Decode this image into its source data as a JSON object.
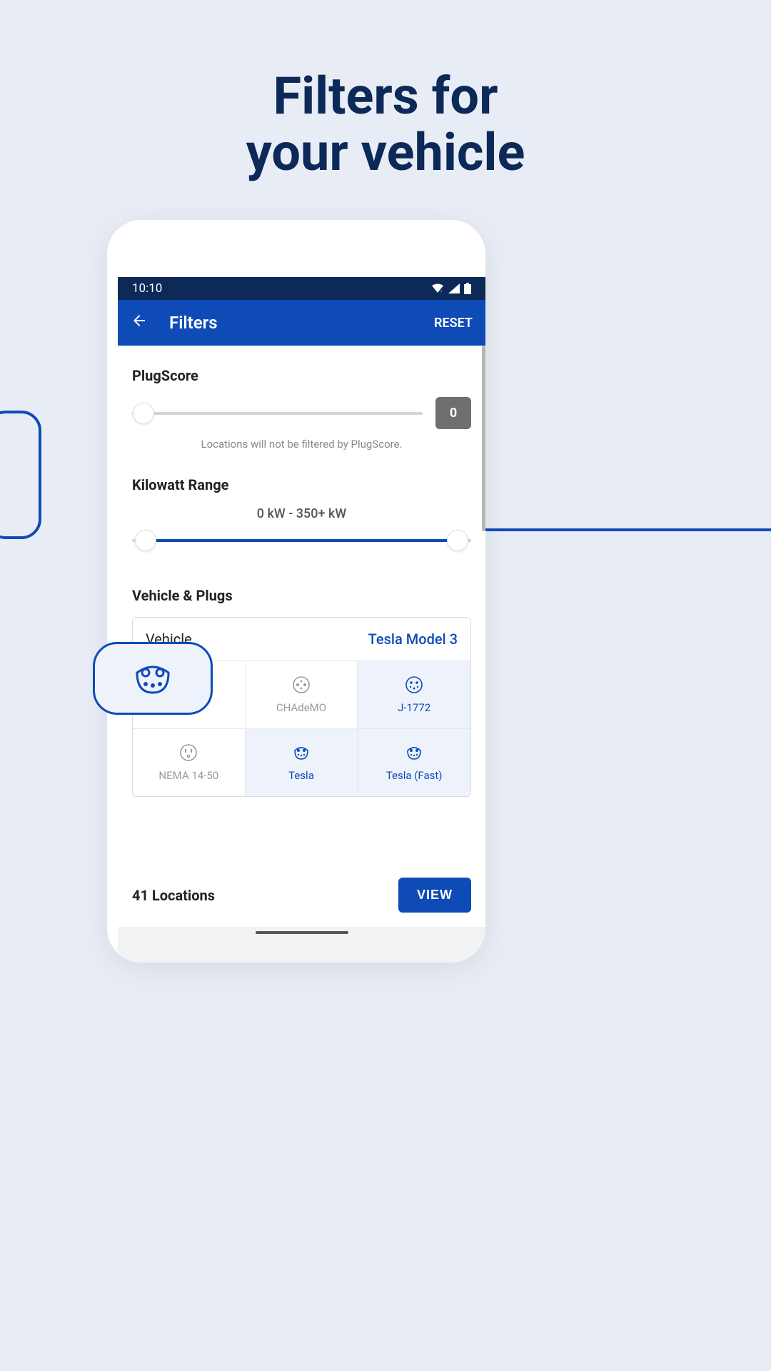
{
  "headline_line1": "Filters for",
  "headline_line2": "your vehicle",
  "status": {
    "time": "10:10"
  },
  "appbar": {
    "title": "Filters",
    "reset": "RESET"
  },
  "plugscore": {
    "title": "PlugScore",
    "value": "0",
    "hint": "Locations will not be filtered by PlugScore."
  },
  "kw": {
    "title": "Kilowatt Range",
    "range_text": "0 kW - 350+ kW"
  },
  "vehicle": {
    "section_title": "Vehicle & Plugs",
    "label": "Vehicle",
    "value": "Tesla Model 3",
    "plugs": [
      {
        "name": "",
        "selected": false
      },
      {
        "name": "CHAdeMO",
        "selected": false
      },
      {
        "name": "J-1772",
        "selected": true
      },
      {
        "name": "NEMA 14-50",
        "selected": false
      },
      {
        "name": "Tesla",
        "selected": true
      },
      {
        "name": "Tesla (Fast)",
        "selected": true
      }
    ]
  },
  "footer": {
    "count": "41 Locations",
    "view": "VIEW"
  }
}
